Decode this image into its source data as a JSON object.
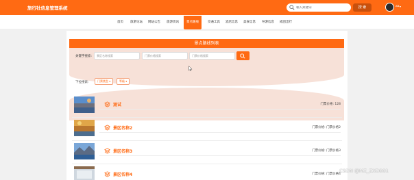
{
  "header": {
    "title": "旅行社信息管理系统",
    "search_placeholder": "输入关键词",
    "search_button": "搜 索",
    "user_name": "aa",
    "user_caret": "▾"
  },
  "nav": [
    {
      "label": "首页"
    },
    {
      "label": "旅游论坛"
    },
    {
      "label": "网站公告"
    },
    {
      "label": "旅游资讯"
    },
    {
      "label": "景点路线"
    },
    {
      "label": "交通工具"
    },
    {
      "label": "酒店信息"
    },
    {
      "label": "美食信息"
    },
    {
      "label": "导游信息"
    },
    {
      "label": "成团出行"
    }
  ],
  "panel": {
    "title": "景点路线列表",
    "keyword_label": "关键字搜索:",
    "inputs": [
      {
        "placeholder": "景区名称搜索"
      },
      {
        "placeholder": "门票价格搜索"
      },
      {
        "placeholder": "门票价格搜索"
      }
    ],
    "pull_label": "下拉搜索:",
    "dropdowns": [
      {
        "label": "门票类型 ▾"
      },
      {
        "label": "等级 ▾"
      }
    ]
  },
  "rows": [
    {
      "name": "测试",
      "price": "门票价格: 128"
    },
    {
      "name": "景区名称2",
      "price": "门票价格: 门票价格2"
    },
    {
      "name": "景区名称3",
      "price": "门票价格: 门票价格3"
    },
    {
      "name": "景区名称4",
      "price": "门票价格: 门票价格4"
    }
  ],
  "watermark": "CSDN @MZ_ZXD001",
  "colors": {
    "accent": "#ff6a13",
    "band": "#f7e1d8"
  }
}
